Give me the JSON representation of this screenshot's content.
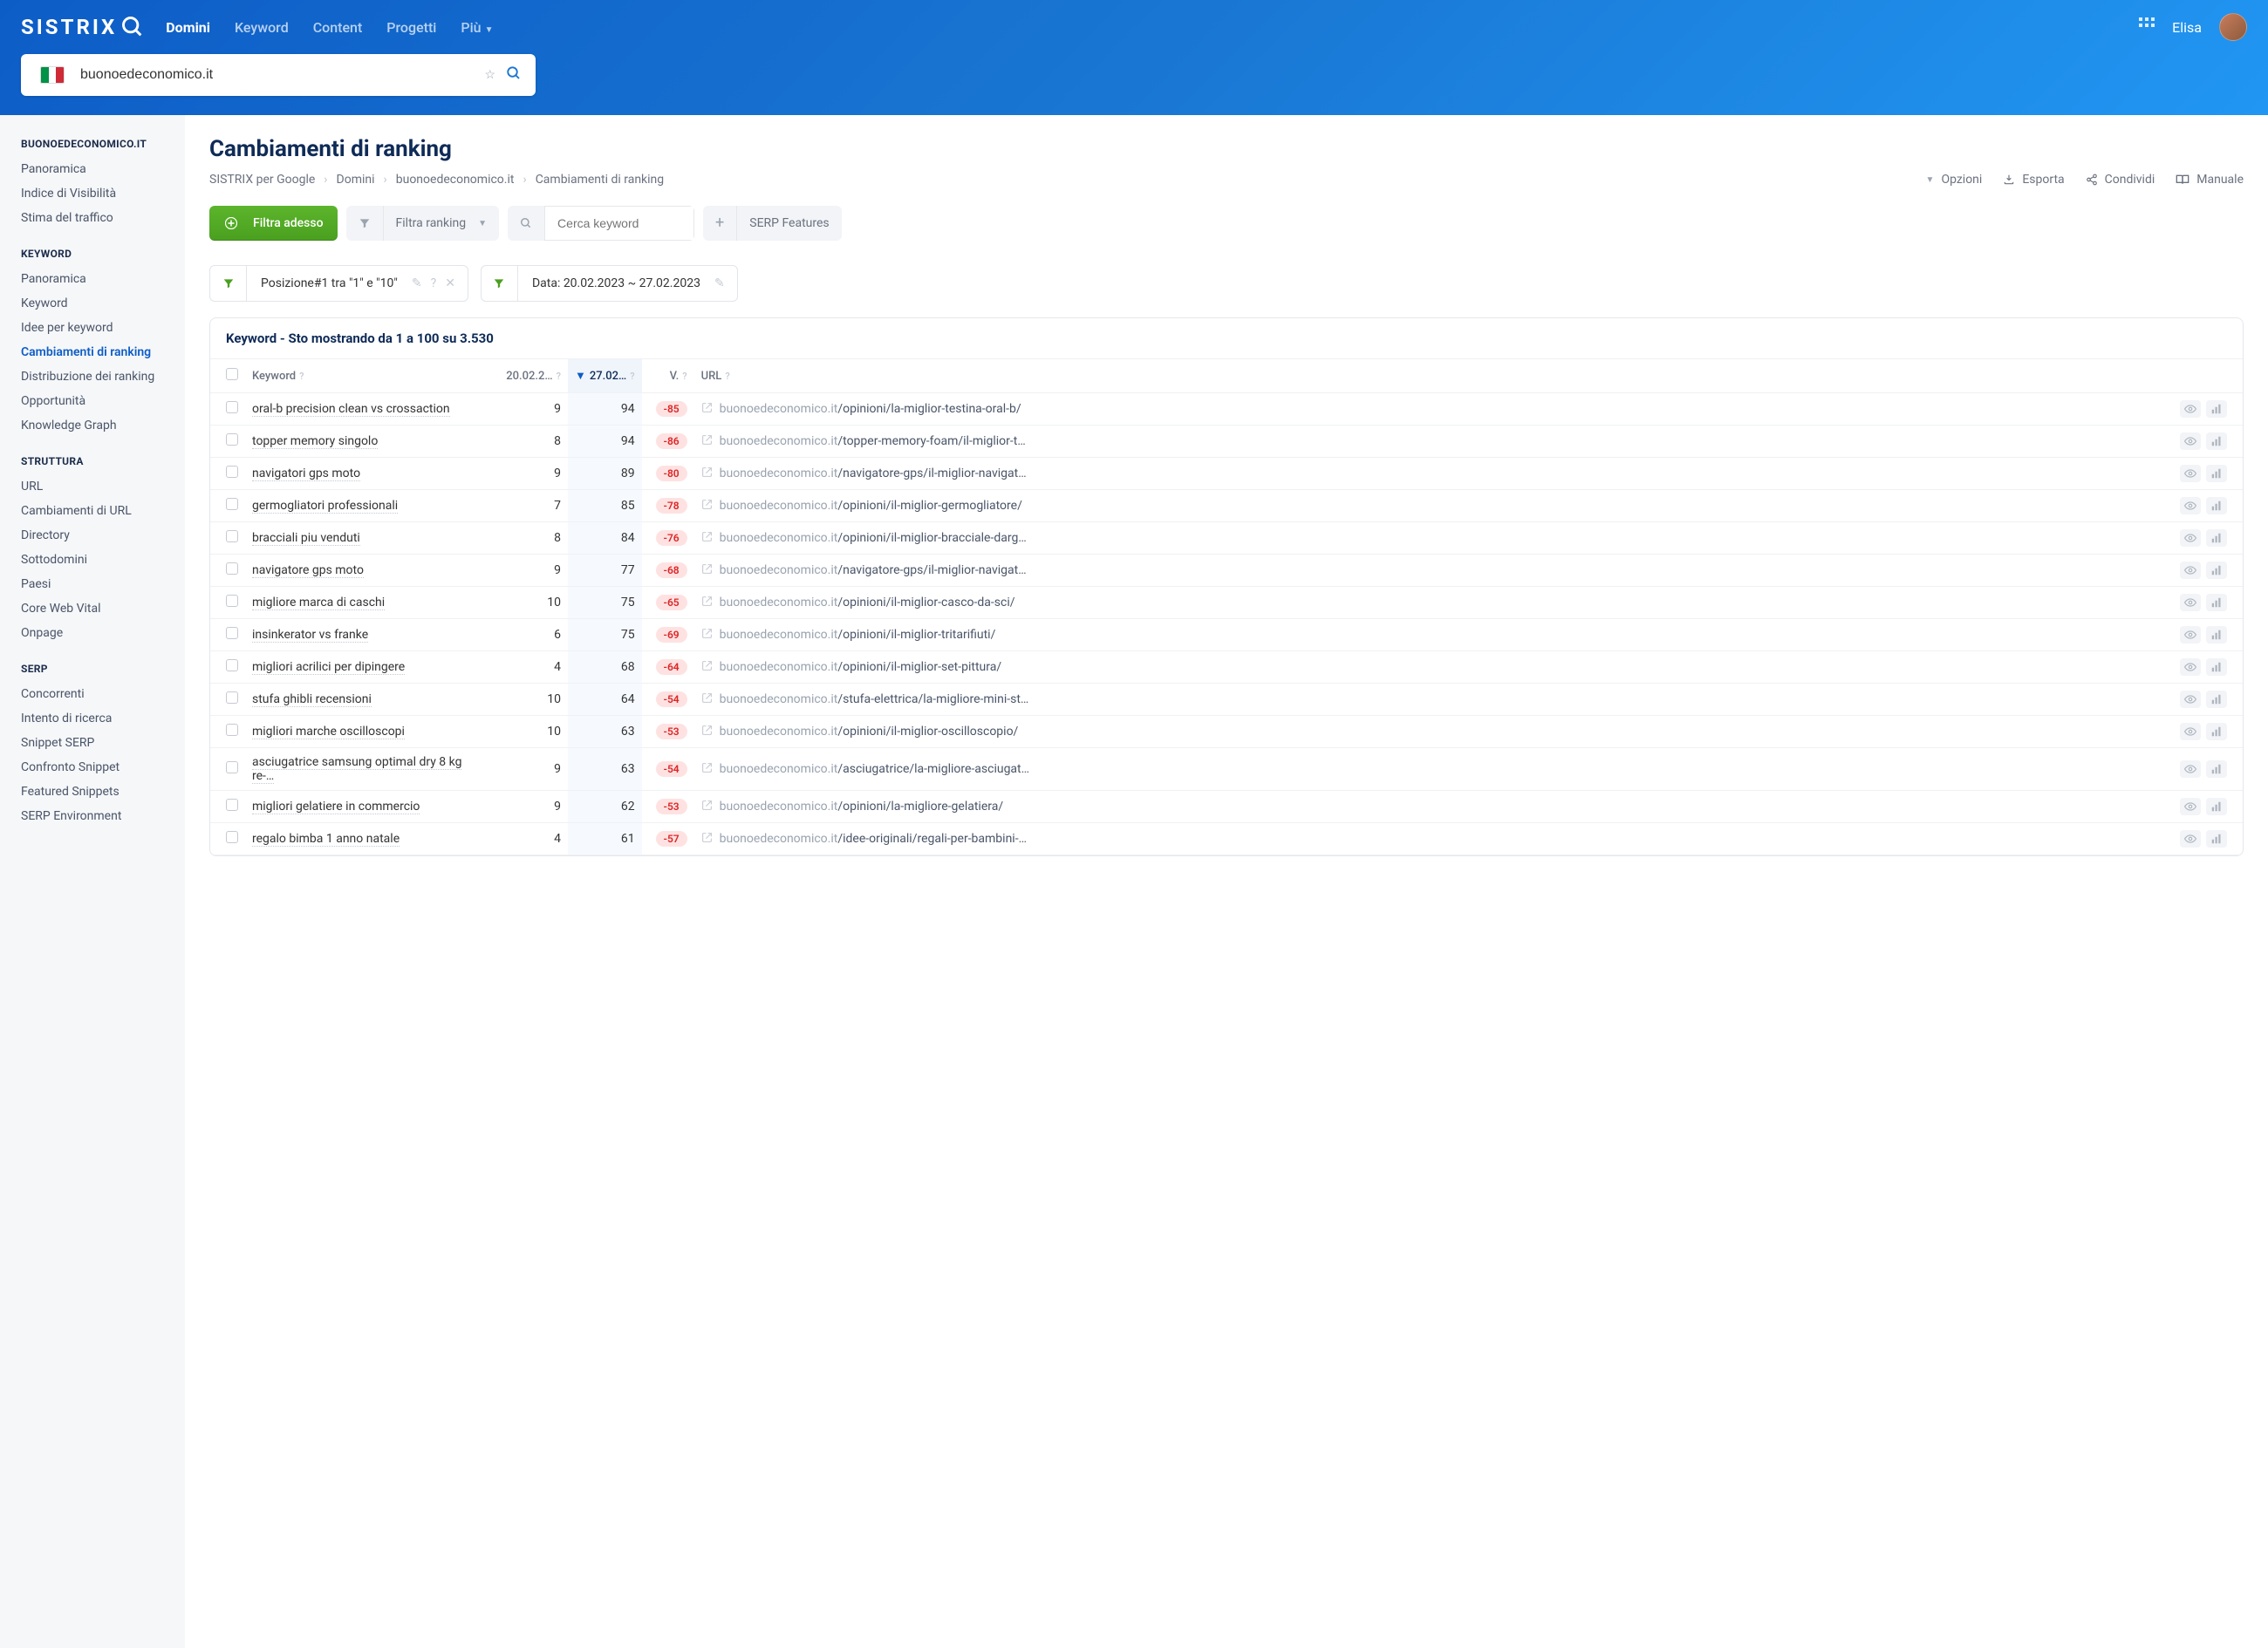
{
  "brand": "SISTRIX",
  "nav": {
    "domini": "Domini",
    "keyword": "Keyword",
    "content": "Content",
    "progetti": "Progetti",
    "piu": "Più"
  },
  "user": {
    "name": "Elisa"
  },
  "search": {
    "value": "buonoedeconomico.it"
  },
  "sidebar": {
    "groups": [
      {
        "header": "BUONOEDECONOMICO.IT",
        "items": [
          "Panoramica",
          "Indice di Visibilità",
          "Stima del traffico"
        ]
      },
      {
        "header": "KEYWORD",
        "items": [
          "Panoramica",
          "Keyword",
          "Idee per keyword",
          "Cambiamenti di ranking",
          "Distribuzione dei ranking",
          "Opportunità",
          "Knowledge Graph"
        ],
        "active": 3
      },
      {
        "header": "STRUTTURA",
        "items": [
          "URL",
          "Cambiamenti di URL",
          "Directory",
          "Sottodomini",
          "Paesi",
          "Core Web Vital",
          "Onpage"
        ]
      },
      {
        "header": "SERP",
        "items": [
          "Concorrenti",
          "Intento di ricerca",
          "Snippet SERP",
          "Confronto Snippet",
          "Featured Snippets",
          "SERP Environment"
        ]
      }
    ]
  },
  "page": {
    "title": "Cambiamenti di ranking",
    "breadcrumb": [
      "SISTRIX per Google",
      "Domini",
      "buonoedeconomico.it",
      "Cambiamenti di ranking"
    ],
    "actions": {
      "opzioni": "Opzioni",
      "esporta": "Esporta",
      "condividi": "Condividi",
      "manuale": "Manuale"
    }
  },
  "toolbar": {
    "filtra_adesso": "Filtra adesso",
    "filtra_ranking": "Filtra ranking",
    "cerca_placeholder": "Cerca keyword",
    "serp_features": "SERP Features"
  },
  "filters": {
    "posizione": "Posizione#1 tra \"1\" e \"10\"",
    "data": "Data: 20.02.2023 ~ 27.02.2023"
  },
  "table": {
    "title": "Keyword - Sto mostrando da 1 a 100 su 3.530",
    "headers": {
      "keyword": "Keyword",
      "date1": "20.02.2…",
      "date2": "27.02…",
      "v": "V.",
      "url": "URL"
    },
    "rows": [
      {
        "kw": "oral-b precision clean vs crossaction",
        "d1": "9",
        "d2": "94",
        "v": "-85",
        "domain": "buonoedeconomico.it",
        "path": "/opinioni/la-miglior-testina-oral-b/"
      },
      {
        "kw": "topper memory singolo",
        "d1": "8",
        "d2": "94",
        "v": "-86",
        "domain": "buonoedeconomico.it",
        "path": "/topper-memory-foam/il-miglior-t…"
      },
      {
        "kw": "navigatori gps moto",
        "d1": "9",
        "d2": "89",
        "v": "-80",
        "domain": "buonoedeconomico.it",
        "path": "/navigatore-gps/il-miglior-navigat…"
      },
      {
        "kw": "germogliatori professionali",
        "d1": "7",
        "d2": "85",
        "v": "-78",
        "domain": "buonoedeconomico.it",
        "path": "/opinioni/il-miglior-germogliatore/"
      },
      {
        "kw": "bracciali piu venduti",
        "d1": "8",
        "d2": "84",
        "v": "-76",
        "domain": "buonoedeconomico.it",
        "path": "/opinioni/il-miglior-bracciale-darg…"
      },
      {
        "kw": "navigatore gps moto",
        "d1": "9",
        "d2": "77",
        "v": "-68",
        "domain": "buonoedeconomico.it",
        "path": "/navigatore-gps/il-miglior-navigat…"
      },
      {
        "kw": "migliore marca di caschi",
        "d1": "10",
        "d2": "75",
        "v": "-65",
        "domain": "buonoedeconomico.it",
        "path": "/opinioni/il-miglior-casco-da-sci/"
      },
      {
        "kw": "insinkerator vs franke",
        "d1": "6",
        "d2": "75",
        "v": "-69",
        "domain": "buonoedeconomico.it",
        "path": "/opinioni/il-miglior-tritarifiuti/"
      },
      {
        "kw": "migliori acrilici per dipingere",
        "d1": "4",
        "d2": "68",
        "v": "-64",
        "domain": "buonoedeconomico.it",
        "path": "/opinioni/il-miglior-set-pittura/"
      },
      {
        "kw": "stufa ghibli recensioni",
        "d1": "10",
        "d2": "64",
        "v": "-54",
        "domain": "buonoedeconomico.it",
        "path": "/stufa-elettrica/la-migliore-mini-st…"
      },
      {
        "kw": "migliori marche oscilloscopi",
        "d1": "10",
        "d2": "63",
        "v": "-53",
        "domain": "buonoedeconomico.it",
        "path": "/opinioni/il-miglior-oscilloscopio/"
      },
      {
        "kw": "asciugatrice samsung optimal dry 8 kg re-…",
        "d1": "9",
        "d2": "63",
        "v": "-54",
        "domain": "buonoedeconomico.it",
        "path": "/asciugatrice/la-migliore-asciugat…"
      },
      {
        "kw": "migliori gelatiere in commercio",
        "d1": "9",
        "d2": "62",
        "v": "-53",
        "domain": "buonoedeconomico.it",
        "path": "/opinioni/la-migliore-gelatiera/"
      },
      {
        "kw": "regalo bimba 1 anno natale",
        "d1": "4",
        "d2": "61",
        "v": "-57",
        "domain": "buonoedeconomico.it",
        "path": "/idee-originali/regali-per-bambini-…"
      }
    ]
  }
}
